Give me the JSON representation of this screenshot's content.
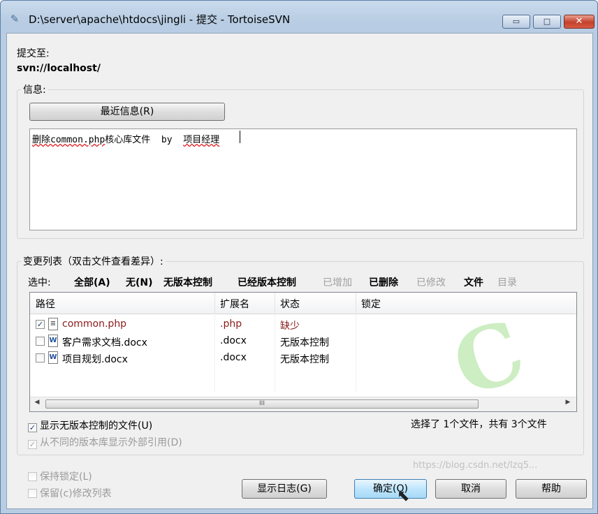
{
  "window": {
    "title": "D:\\server\\apache\\htdocs\\jingli - 提交 - TortoiseSVN",
    "close_glyph": "✕",
    "minimize_glyph": "▭",
    "maximize_glyph": "□"
  },
  "commit_to": {
    "label": "提交至:",
    "url": "svn://localhost/"
  },
  "message": {
    "group_label": "信息:",
    "recent_button": "最近信息(R)",
    "text_part1": "删除common.php",
    "text_part2": "核心库文件  by  ",
    "text_part3": "项目经理"
  },
  "changes": {
    "group_label": "变更列表（双击文件查看差异）:",
    "select_label": "选中:",
    "select_links": [
      {
        "label": "全部(A)",
        "enabled": true
      },
      {
        "label": "无(N)",
        "enabled": true
      },
      {
        "label": "无版本控制",
        "enabled": true
      },
      {
        "label": "已经版本控制",
        "enabled": true
      },
      {
        "label": "已增加",
        "enabled": false
      },
      {
        "label": "已删除",
        "enabled": true
      },
      {
        "label": "已修改",
        "enabled": false
      },
      {
        "label": "文件",
        "enabled": true
      },
      {
        "label": "目录",
        "enabled": false
      }
    ],
    "columns": [
      "路径",
      "扩展名",
      "状态",
      "锁定"
    ],
    "rows": [
      {
        "checked": true,
        "path": "common.php",
        "ext": ".php",
        "status": "缺少",
        "lock": "",
        "icon": "php-file-icon"
      },
      {
        "checked": false,
        "path": "客户需求文档.docx",
        "ext": ".docx",
        "status": "无版本控制",
        "lock": "",
        "icon": "word-file-icon"
      },
      {
        "checked": false,
        "path": "项目规划.docx",
        "ext": ".docx",
        "status": "无版本控制",
        "lock": "",
        "icon": "word-file-icon"
      }
    ],
    "scroll_thumb_glyph": "III",
    "show_unversioned": {
      "label": "显示无版本控制的文件(U)",
      "checked": true
    },
    "show_externals": {
      "label": "从不同的版本库显示外部引用(D)",
      "checked": true
    },
    "summary": "选择了 1个文件，共有 3个文件"
  },
  "options": {
    "keep_locks": {
      "label": "保持锁定(L)",
      "checked": false
    },
    "keep_changelists": {
      "label": "保留(c)修改列表",
      "checked": false
    }
  },
  "buttons": {
    "show_log": "显示日志(G)",
    "ok": "确定(O)",
    "cancel": "取消",
    "help": "帮助"
  },
  "watermark_url": "https://blog.csdn.net/lzq5..."
}
